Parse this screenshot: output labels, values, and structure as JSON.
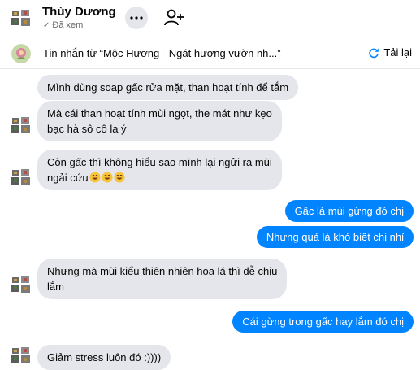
{
  "header": {
    "name": "Thùy Dương",
    "status": "Đã xem"
  },
  "banner": {
    "text": "Tin nhắn từ  “Mộc Hương - Ngát hương vườn nh...”",
    "reload_label": "Tải lại"
  },
  "messages": [
    {
      "side": "in",
      "text": "Mình dùng soap gấc rửa mặt, than hoạt tính để tắm"
    },
    {
      "side": "in",
      "line1": "Mà cái than hoạt tính mùi ngọt, the mát như kẹo",
      "line2": "bạc hà sô cô la ý"
    },
    {
      "side": "in",
      "line1": "Còn gấc thì không hiểu sao mình lại ngửi ra mùi",
      "line2": "ngải cứu",
      "emoji": [
        "grin-emoji",
        "grin-emoji",
        "grin-emoji"
      ]
    },
    {
      "side": "out",
      "text": "Gấc là mùi gừng đó chị"
    },
    {
      "side": "out",
      "text": "Nhưng quả là khó biết chị nhỉ"
    },
    {
      "side": "in",
      "line1": "Nhưng mà mùi kiểu thiên nhiên hoa lá thì dễ chịu",
      "line2": "lắm"
    },
    {
      "side": "out",
      "text": "Cái gừng trong gấc hay lắm đó chị"
    },
    {
      "side": "in",
      "text": "Giảm stress luôn đó :))))"
    }
  ],
  "colors": {
    "outgoing_bubble": "#0084ff",
    "incoming_bubble": "#e4e6eb",
    "accent": "#0084ff"
  }
}
